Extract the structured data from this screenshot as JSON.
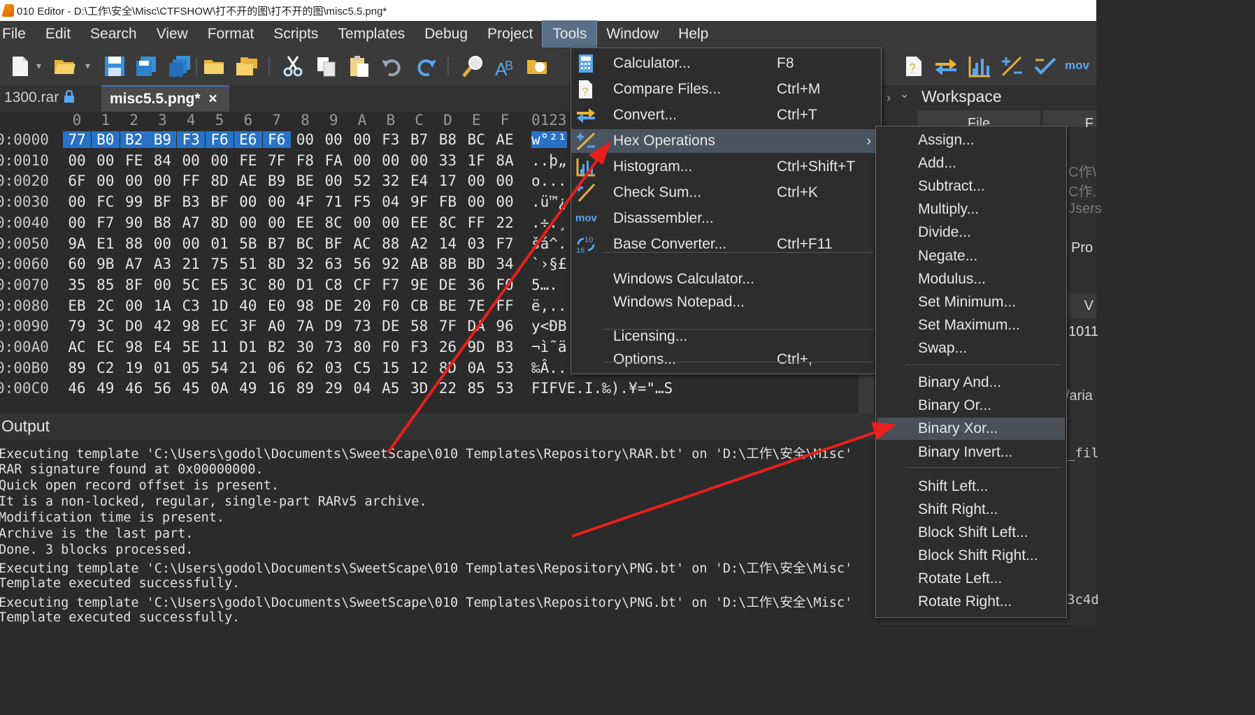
{
  "window": {
    "title": "010 Editor - D:\\工作\\安全\\Misc\\CTFSHOW\\打不开的图\\打不开的图\\misc5.5.png*"
  },
  "menubar": [
    "File",
    "Edit",
    "Search",
    "View",
    "Format",
    "Scripts",
    "Templates",
    "Debug",
    "Project",
    "Tools",
    "Window",
    "Help"
  ],
  "menubar_active": "Tools",
  "toolbar": {
    "icons": [
      "new-file-icon",
      "open-folder-icon",
      "save-icon",
      "save-as-icon",
      "save-all-icon",
      "open-folder2-icon",
      "open-workspace-icon",
      "cut-icon",
      "copy-icon",
      "paste-icon",
      "undo-icon",
      "redo-icon",
      "find-icon",
      "replace-icon",
      "goto-icon",
      "compare-icon",
      "convert-icon",
      "histogram-icon",
      "hex-operations-icon",
      "checksum-icon"
    ],
    "mov_label": "mov"
  },
  "tabs": [
    {
      "label": "1300.rar",
      "locked": true
    },
    {
      "label": "misc5.5.png*",
      "active": true,
      "close": "×"
    }
  ],
  "hex": {
    "header_cols": [
      "0",
      "1",
      "2",
      "3",
      "4",
      "5",
      "6",
      "7",
      "8",
      "9",
      "A",
      "B",
      "C",
      "D",
      "E",
      "F"
    ],
    "ascii_header": "0123",
    "rows": [
      {
        "offset": "0:0000",
        "bytes": [
          "77",
          "B0",
          "B2",
          "B9",
          "F3",
          "F6",
          "E6",
          "F6",
          "00",
          "00",
          "00",
          "F3",
          "B7",
          "B8",
          "BC",
          "AE"
        ],
        "ascii": "w°²¹"
      },
      {
        "offset": "0:0010",
        "bytes": [
          "00",
          "00",
          "FE",
          "84",
          "00",
          "00",
          "FE",
          "7F",
          "F8",
          "FA",
          "00",
          "00",
          "00",
          "33",
          "1F",
          "8A"
        ],
        "ascii": "..þ„"
      },
      {
        "offset": "0:0020",
        "bytes": [
          "6F",
          "00",
          "00",
          "00",
          "FF",
          "8D",
          "AE",
          "B9",
          "BE",
          "00",
          "52",
          "32",
          "E4",
          "17",
          "00",
          "00"
        ],
        "ascii": "o..."
      },
      {
        "offset": "0:0030",
        "bytes": [
          "00",
          "FC",
          "99",
          "BF",
          "B3",
          "BF",
          "00",
          "00",
          "4F",
          "71",
          "F5",
          "04",
          "9F",
          "FB",
          "00",
          "00"
        ],
        "ascii": ".ü™¿"
      },
      {
        "offset": "0:0040",
        "bytes": [
          "00",
          "F7",
          "90",
          "B8",
          "A7",
          "8D",
          "00",
          "00",
          "EE",
          "8C",
          "00",
          "00",
          "EE",
          "8C",
          "FF",
          "22"
        ],
        "ascii": ".÷.¸"
      },
      {
        "offset": "0:0050",
        "bytes": [
          "9A",
          "E1",
          "88",
          "00",
          "00",
          "01",
          "5B",
          "B7",
          "BC",
          "BF",
          "AC",
          "88",
          "A2",
          "14",
          "03",
          "F7"
        ],
        "ascii": "šá^."
      },
      {
        "offset": "0:0060",
        "bytes": [
          "60",
          "9B",
          "A7",
          "A3",
          "21",
          "75",
          "51",
          "8D",
          "32",
          "63",
          "56",
          "92",
          "AB",
          "8B",
          "BD",
          "34"
        ],
        "ascii": "`›§£"
      },
      {
        "offset": "0:0070",
        "bytes": [
          "35",
          "85",
          "8F",
          "00",
          "5C",
          "E5",
          "3C",
          "80",
          "D1",
          "C8",
          "CF",
          "F7",
          "9E",
          "DE",
          "36",
          "F0"
        ],
        "ascii": "5…."
      },
      {
        "offset": "0:0080",
        "bytes": [
          "EB",
          "2C",
          "00",
          "1A",
          "C3",
          "1D",
          "40",
          "E0",
          "98",
          "DE",
          "20",
          "F0",
          "CB",
          "BE",
          "7E",
          "FF"
        ],
        "ascii": "ë,.."
      },
      {
        "offset": "0:0090",
        "bytes": [
          "79",
          "3C",
          "D0",
          "42",
          "98",
          "EC",
          "3F",
          "A0",
          "7A",
          "D9",
          "73",
          "DE",
          "58",
          "7F",
          "DA",
          "96"
        ],
        "ascii": "y<ÐB"
      },
      {
        "offset": "0:00A0",
        "bytes": [
          "AC",
          "EC",
          "98",
          "E4",
          "5E",
          "11",
          "D1",
          "B2",
          "30",
          "73",
          "80",
          "F0",
          "F3",
          "26",
          "9D",
          "B3"
        ],
        "ascii": "¬ì˜ä"
      },
      {
        "offset": "0:00B0",
        "bytes": [
          "89",
          "C2",
          "19",
          "01",
          "05",
          "54",
          "21",
          "06",
          "62",
          "03",
          "C5",
          "15",
          "12",
          "8D",
          "0A",
          "53"
        ],
        "ascii": "‰Â.."
      },
      {
        "offset": "0:00C0",
        "bytes": [
          "46",
          "49",
          "46",
          "56",
          "45",
          "0A",
          "49",
          "16",
          "89",
          "29",
          "04",
          "A5",
          "3D",
          "22",
          "85",
          "53"
        ],
        "ascii": "FIFVE.I.‰).¥=\"…S"
      }
    ]
  },
  "output": {
    "title": "Output",
    "lines": [
      "Executing template 'C:\\Users\\godol\\Documents\\SweetScape\\010 Templates\\Repository\\RAR.bt' on 'D:\\工作\\安全\\Misc'",
      "RAR signature found at 0x00000000.",
      "Quick open record offset is present.",
      "It is a non-locked, regular, single-part RARv5 archive.",
      "Modification time is present.",
      "Archive is the last part.",
      "Done. 3 blocks processed.",
      "Executing template 'C:\\Users\\godol\\Documents\\SweetScape\\010 Templates\\Repository\\PNG.bt' on 'D:\\工作\\安全\\Misc'",
      "Template executed successfully.",
      "Executing template 'C:\\Users\\godol\\Documents\\SweetScape\\010 Templates\\Repository\\PNG.bt' on 'D:\\工作\\安全\\Misc'",
      "Template executed successfully."
    ]
  },
  "workspace": {
    "title": "Workspace",
    "fragments": [
      "File",
      "F",
      "C作\\",
      "C作.",
      "Jsers",
      "Pro",
      "V",
      "1011",
      "/aria",
      "_fil",
      "3c4d"
    ]
  },
  "tools_menu": {
    "items": [
      {
        "label": "Calculator...",
        "shortcut": "F8",
        "icon": "calculator-icon"
      },
      {
        "label": "Compare Files...",
        "shortcut": "Ctrl+M",
        "icon": "compare-files-icon"
      },
      {
        "label": "Convert...",
        "shortcut": "Ctrl+T",
        "icon": "convert-icon"
      },
      {
        "label": "Hex Operations",
        "shortcut": "",
        "icon": "hex-operations-icon",
        "submenu": true,
        "highlighted": true
      },
      {
        "label": "Histogram...",
        "shortcut": "Ctrl+Shift+T",
        "icon": "histogram-icon"
      },
      {
        "label": "Check Sum...",
        "shortcut": "Ctrl+K",
        "icon": "checksum-icon"
      },
      {
        "label": "Disassembler...",
        "shortcut": "",
        "icon": "disassembler-icon",
        "icon_text": "mov"
      },
      {
        "label": "Base Converter...",
        "shortcut": "Ctrl+F11",
        "icon": "base-converter-icon"
      },
      {
        "label": "Windows Calculator...",
        "shortcut": ""
      },
      {
        "label": "Windows Notepad...",
        "shortcut": ""
      },
      {
        "label": "Licensing...",
        "shortcut": ""
      },
      {
        "label": "Options...",
        "shortcut": "Ctrl+,"
      }
    ]
  },
  "hex_submenu": {
    "items": [
      "Assign...",
      "Add...",
      "Subtract...",
      "Multiply...",
      "Divide...",
      "Negate...",
      "Modulus...",
      "Set Minimum...",
      "Set Maximum...",
      "Swap...",
      "Binary And...",
      "Binary Or...",
      "Binary Xor...",
      "Binary Invert...",
      "Shift Left...",
      "Shift Right...",
      "Block Shift Left...",
      "Block Shift Right...",
      "Rotate Left...",
      "Rotate Right..."
    ],
    "highlighted": "Binary Xor..."
  },
  "colors": {
    "selection": "#2872c7",
    "menu_highlight": "#4a5460",
    "annotation_arrow": "#e8201e"
  }
}
